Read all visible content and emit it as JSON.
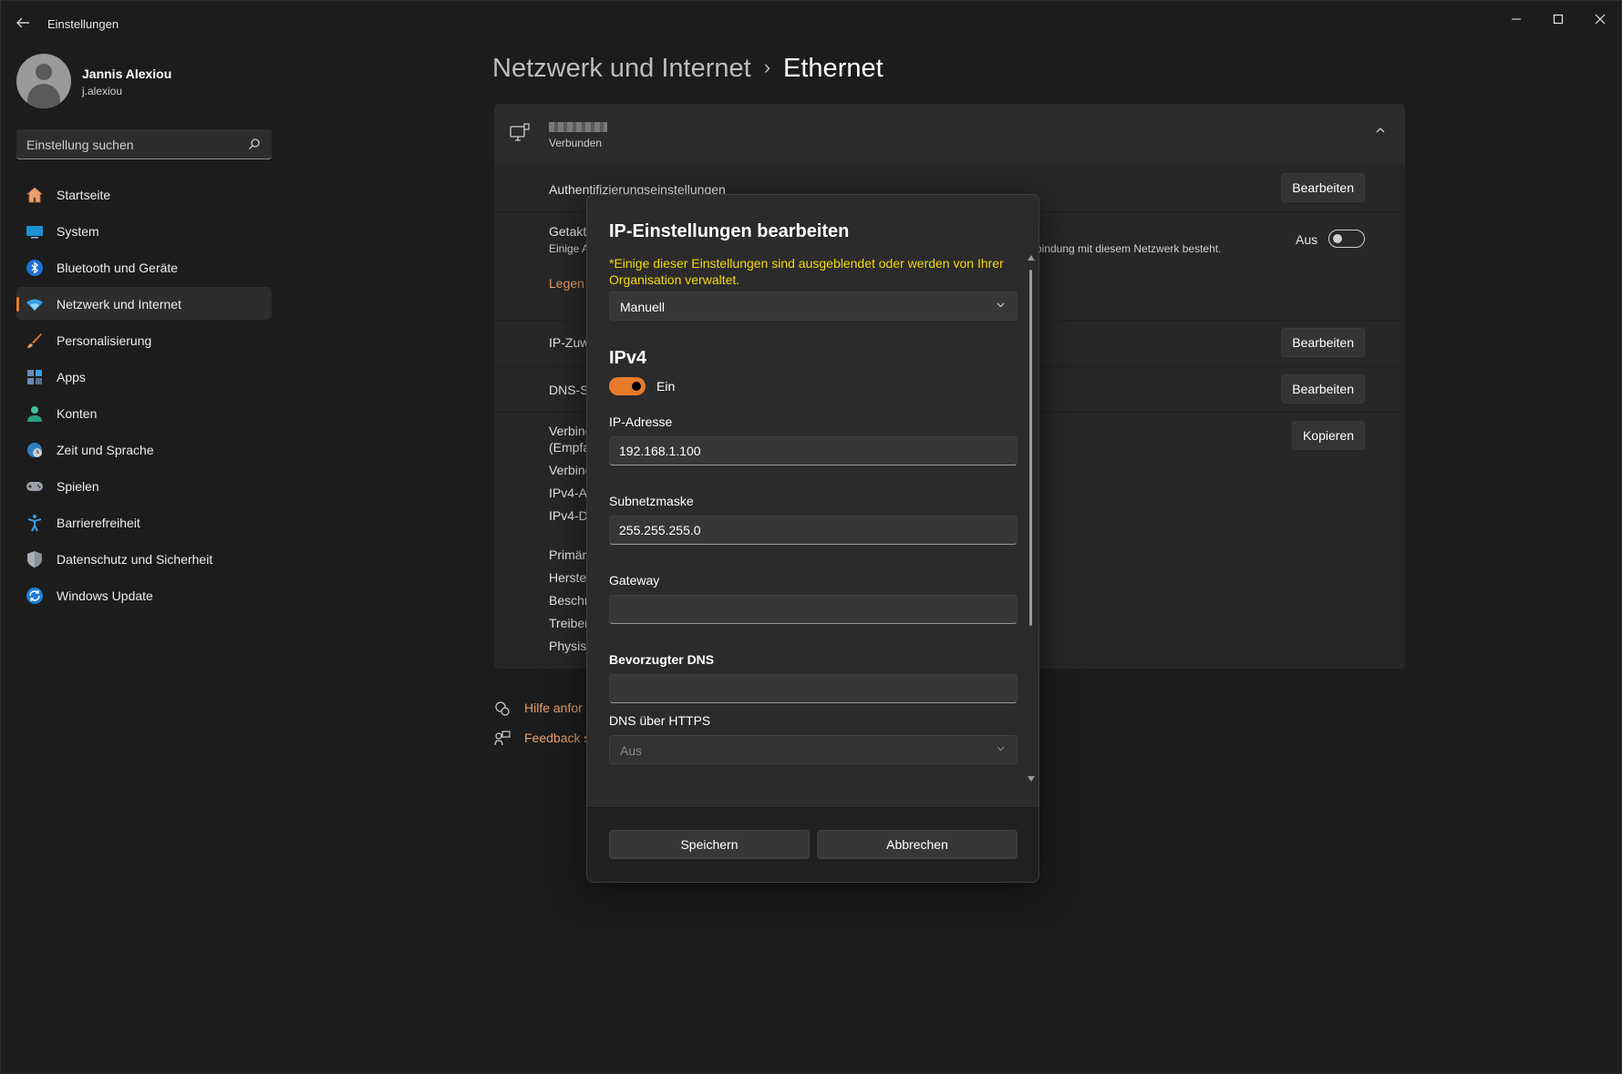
{
  "window": {
    "title": "Einstellungen",
    "controls": {
      "minimize": "—",
      "maximize": "☐",
      "close": "✕"
    }
  },
  "profile": {
    "name": "Jannis Alexiou",
    "username": "j.alexiou"
  },
  "search": {
    "placeholder": "Einstellung suchen"
  },
  "sidebar": {
    "items": [
      {
        "label": "Startseite",
        "icon": "home-icon"
      },
      {
        "label": "System",
        "icon": "monitor-icon"
      },
      {
        "label": "Bluetooth und Geräte",
        "icon": "bluetooth-icon"
      },
      {
        "label": "Netzwerk und Internet",
        "icon": "wifi-icon",
        "active": true
      },
      {
        "label": "Personalisierung",
        "icon": "brush-icon"
      },
      {
        "label": "Apps",
        "icon": "apps-icon"
      },
      {
        "label": "Konten",
        "icon": "account-icon"
      },
      {
        "label": "Zeit und Sprache",
        "icon": "globe-clock-icon"
      },
      {
        "label": "Spielen",
        "icon": "gamepad-icon"
      },
      {
        "label": "Barrierefreiheit",
        "icon": "accessibility-icon"
      },
      {
        "label": "Datenschutz und Sicherheit",
        "icon": "shield-icon"
      },
      {
        "label": "Windows Update",
        "icon": "update-icon"
      }
    ]
  },
  "header": {
    "parent": "Netzwerk und Internet",
    "separator": "›",
    "current": "Ethernet"
  },
  "ethernet_card": {
    "status": "Verbunden",
    "rows": {
      "auth_label": "Authentifizierungseinstellungen",
      "auth_button": "Bearbeiten",
      "metered_label": "Getakt",
      "metered_sub": "Einige A",
      "metered_desc": "rbindung mit diesem Netzwerk besteht.",
      "metered_toggle": "Aus",
      "metered_link": "Legen",
      "ip_label": "IP-Zuw",
      "ip_button": "Bearbeiten",
      "dns_label": "DNS-S",
      "dns_button": "Bearbeiten",
      "props_lines": [
        "Verbind",
        "(Empfa",
        "Verbind",
        "IPv4-A",
        "IPv4-D"
      ],
      "copy_button": "Kopieren",
      "hw_lines": [
        "Primär",
        "Herstel",
        "Beschr",
        "Treiber",
        "Physisc"
      ]
    }
  },
  "help": {
    "get_help": "Hilfe anfor",
    "feedback": "Feedback s"
  },
  "dialog": {
    "title": "IP-Einstellungen bearbeiten",
    "warning": "*Einige dieser Einstellungen sind ausgeblendet oder werden von Ihrer Organisation verwaltet.",
    "mode": "Manuell",
    "ipv4_heading": "IPv4",
    "ipv4_toggle": "Ein",
    "ip_label": "IP-Adresse",
    "ip_value": "192.168.1.100",
    "subnet_label": "Subnetzmaske",
    "subnet_value": "255.255.255.0",
    "gateway_label": "Gateway",
    "gateway_value": "",
    "dns_label": "Bevorzugter DNS",
    "dns_value": "",
    "doh_label": "DNS über HTTPS",
    "doh_value": "Aus",
    "save": "Speichern",
    "cancel": "Abbrechen"
  },
  "colors": {
    "accent": "#e77b2b",
    "warning": "#f5d90a",
    "background": "#1c1c1c"
  }
}
